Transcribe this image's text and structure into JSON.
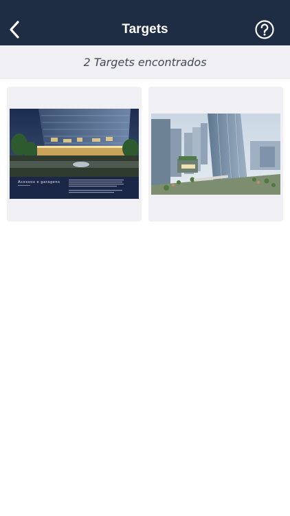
{
  "navbar": {
    "title": "Targets",
    "back_icon": "chevron-left-icon",
    "help_icon": "question-circle-icon"
  },
  "results": {
    "count_label": "2 Targets encontrados"
  },
  "targets": [
    {
      "caption": "Acessos e garagens",
      "description": "rendering of office tower entrance at night with caption panel"
    },
    {
      "description": "aerial rendering of glass office towers and plaza"
    }
  ],
  "colors": {
    "navbar": "#1f2d44",
    "subheader": "#efeff4",
    "card": "#efeff4"
  }
}
